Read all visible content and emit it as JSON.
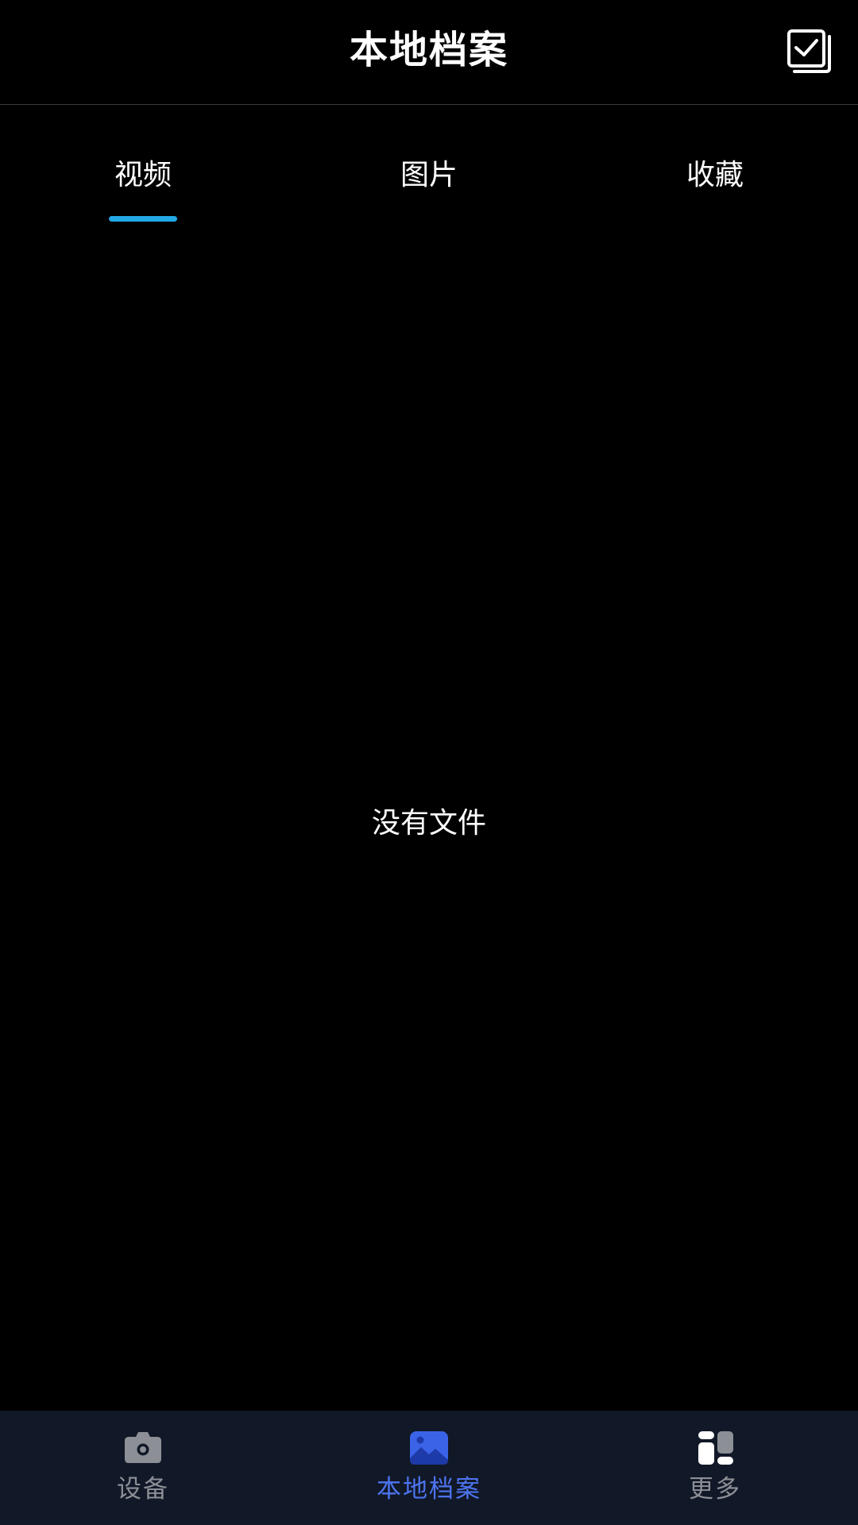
{
  "header": {
    "title": "本地档案",
    "select_icon": "checklist-icon"
  },
  "tabs": [
    {
      "label": "视频",
      "active": true
    },
    {
      "label": "图片",
      "active": false
    },
    {
      "label": "收藏",
      "active": false
    }
  ],
  "main": {
    "empty_text": "没有文件"
  },
  "bottom_nav": {
    "items": [
      {
        "label": "设备",
        "icon": "camera-icon",
        "active": false
      },
      {
        "label": "本地档案",
        "icon": "image-icon",
        "active": true
      },
      {
        "label": "更多",
        "icon": "grid-icon",
        "active": false
      }
    ]
  },
  "colors": {
    "background": "#000000",
    "tab_indicator": "#22a9e6",
    "nav_background": "#111827",
    "nav_active": "#4d74f0",
    "nav_inactive": "#8c8f96"
  }
}
